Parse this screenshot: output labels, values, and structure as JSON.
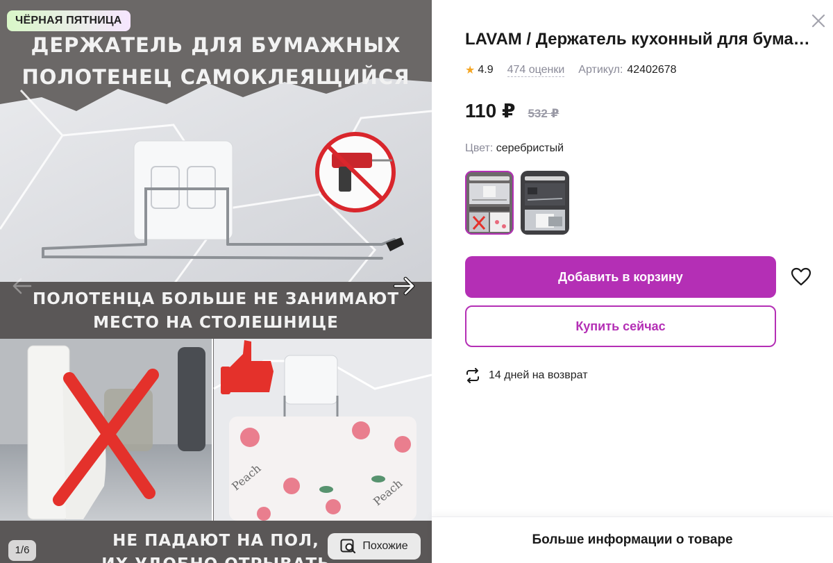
{
  "gallery": {
    "badge": "ЧЁРНАЯ ПЯТНИЦА",
    "heading_top_line1": "ДЕРЖАТЕЛЬ ДЛЯ БУМАЖНЫХ",
    "heading_top_line2": "ПОЛОТЕНЕЦ САМОКЛЕЯЩИЙСЯ",
    "heading_mid_line1": "ПОЛОТЕНЦА БОЛЬШЕ НЕ ЗАНИМАЮТ",
    "heading_mid_line2": "МЕСТО НА СТОЛЕШНИЦЕ",
    "heading_bottom_line1": "НЕ ПАДАЮТ НА ПОЛ,",
    "heading_bottom_line2": "ИХ УДОБНО ОТРЫВАТЬ",
    "towel_text": "Peach",
    "counter": "1/6",
    "similar_label": "Похожие"
  },
  "product": {
    "title": "LAVAM / Держатель кухонный для бумажных полотенец самоклеящийся",
    "rating": "4.9",
    "reviews": "474 оценки",
    "article_label": "Артикул:",
    "article": "42402678",
    "price": "110 ₽",
    "old_price": "532 ₽",
    "color_label": "Цвет:",
    "color_value": "серебристый"
  },
  "actions": {
    "add_to_cart": "Добавить в корзину",
    "buy_now": "Купить сейчас",
    "return_text": "14 дней на возврат",
    "more_info": "Больше информации о товаре"
  },
  "colors": {
    "accent": "#b42fb5",
    "star": "#f5a623",
    "muted": "#8a8a98"
  },
  "icons": {
    "close": "close-icon",
    "favorite": "heart-icon",
    "return": "return-arrows-icon",
    "similar": "image-search-icon",
    "next": "arrow-right-icon",
    "prev": "arrow-left-icon"
  }
}
